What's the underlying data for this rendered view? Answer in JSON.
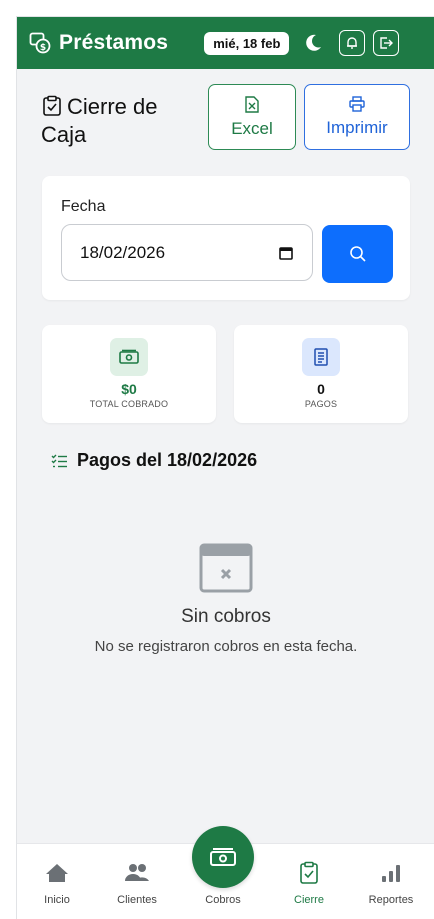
{
  "header": {
    "app_title": "Préstamos",
    "date_badge": "mié, 18 feb"
  },
  "page": {
    "title": "Cierre de Caja"
  },
  "actions": {
    "excel_label": "Excel",
    "print_label": "Imprimir"
  },
  "filter": {
    "date_label": "Fecha",
    "date_value": "18/02/2026"
  },
  "stats": {
    "total_value": "$0",
    "total_label": "TOTAL COBRADO",
    "count_value": "0",
    "count_label": "PAGOS"
  },
  "payments": {
    "heading": "Pagos del 18/02/2026",
    "empty_title": "Sin cobros",
    "empty_text": "No se registraron cobros en esta fecha."
  },
  "nav": {
    "items": [
      {
        "label": "Inicio",
        "icon": "home-icon"
      },
      {
        "label": "Clientes",
        "icon": "users-icon"
      },
      {
        "label": "Cobros",
        "icon": "cash-icon"
      },
      {
        "label": "Cierre",
        "icon": "clipboard-check-icon",
        "active": true
      },
      {
        "label": "Reportes",
        "icon": "bar-chart-icon"
      }
    ]
  },
  "colors": {
    "brand_green": "#1e7a45",
    "primary_blue": "#0d6efd",
    "background": "#f2f3f5"
  }
}
